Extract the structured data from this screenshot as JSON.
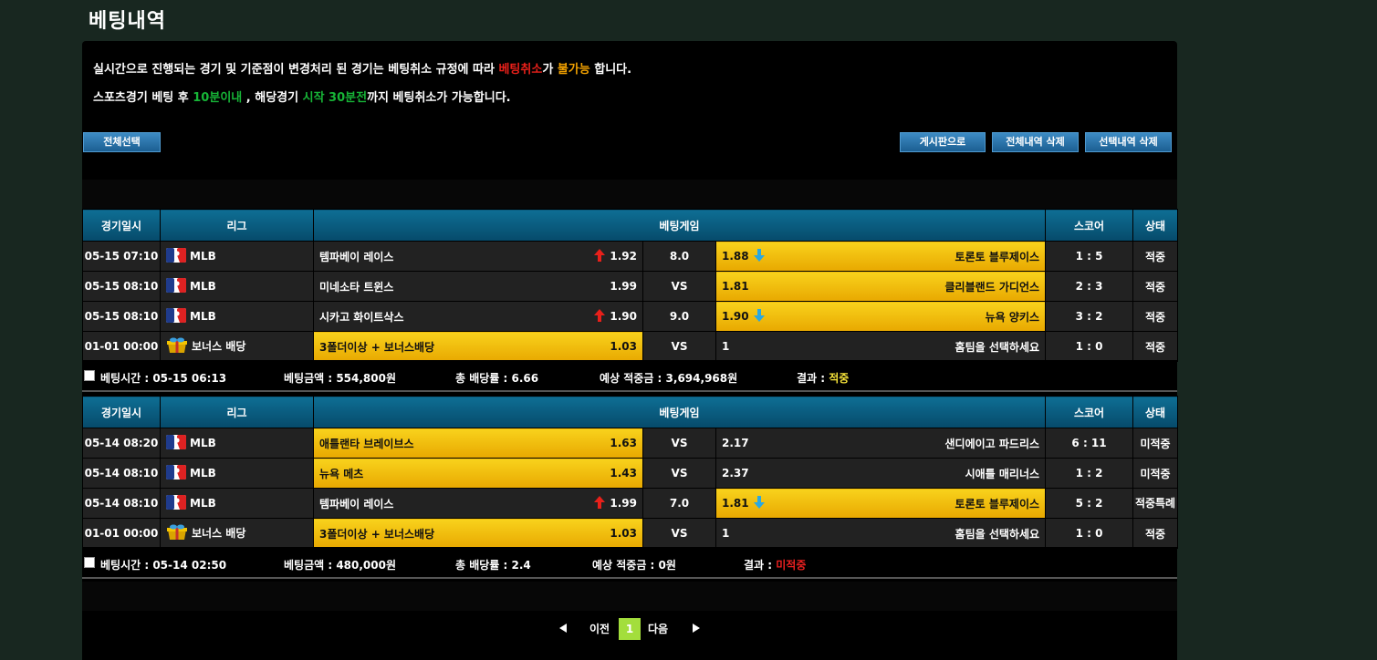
{
  "page_title": "베팅내역",
  "notice": {
    "line1_a": "실시간으로 진행되는 경기 및 기준점이 변경처리 된 경기는 베팅취소 규정에 따라 ",
    "line1_red": "베팅취소",
    "line1_b": "가 ",
    "line1_orange": "불가능",
    "line1_c": " 합니다.",
    "line2_a": "스포츠경기 베팅 후 ",
    "line2_green1": "10분이내",
    "line2_b": " , 해당경기 ",
    "line2_green2": "시작 30분전",
    "line2_c": "까지 베팅취소가 가능합니다."
  },
  "buttons": {
    "select_all": "전체선택",
    "to_board": "게시판으로",
    "delete_all": "전체내역 삭제",
    "delete_selected": "선택내역 삭제"
  },
  "headers": {
    "date": "경기일시",
    "league": "리그",
    "game": "베팅게임",
    "score": "스코어",
    "status": "상태"
  },
  "slips": [
    {
      "rows": [
        {
          "date": "05-15 07:10",
          "league": "MLB",
          "league_icon": "mlb-logo-icon",
          "home": "템파베이 레이스",
          "home_odds": "1.92",
          "home_arrow": "up",
          "mid": "8.0",
          "away_odds": "1.88",
          "away_arrow": "down",
          "away": "토론토 블루제이스",
          "pick": "away",
          "score": "1 : 5",
          "status": "적중"
        },
        {
          "date": "05-15 08:10",
          "league": "MLB",
          "league_icon": "mlb-logo-icon",
          "home": "미네소타 트윈스",
          "home_odds": "1.99",
          "home_arrow": "",
          "mid": "VS",
          "away_odds": "1.81",
          "away_arrow": "",
          "away": "클리블랜드 가디언스",
          "pick": "away",
          "score": "2 : 3",
          "status": "적중"
        },
        {
          "date": "05-15 08:10",
          "league": "MLB",
          "league_icon": "mlb-logo-icon",
          "home": "시카고 화이트삭스",
          "home_odds": "1.90",
          "home_arrow": "up",
          "mid": "9.0",
          "away_odds": "1.90",
          "away_arrow": "down",
          "away": "뉴욕 양키스",
          "pick": "away",
          "score": "3 : 2",
          "status": "적중"
        },
        {
          "date": "01-01 00:00",
          "league": "보너스 배당",
          "league_icon": "gift-box-icon",
          "home": "3폴더이상 + 보너스배당",
          "home_odds": "1.03",
          "home_arrow": "",
          "mid": "VS",
          "away_odds": "1",
          "away_arrow": "",
          "away": "홈팀을 선택하세요",
          "pick": "home",
          "score": "1 : 0",
          "status": "적중"
        }
      ],
      "summary": {
        "time_label": "베팅시간 : ",
        "time": "05-15 06:13",
        "amount_label": "베팅금액 : ",
        "amount": "554,800원",
        "rate_label": "총 배당률 : ",
        "rate": "6.66",
        "expected_label": "예상 적중금 : ",
        "expected": "3,694,968원",
        "result_label": "결과 : ",
        "result": "적중"
      }
    },
    {
      "rows": [
        {
          "date": "05-14 08:20",
          "league": "MLB",
          "league_icon": "mlb-logo-icon",
          "home": "애틀랜타 브레이브스",
          "home_odds": "1.63",
          "home_arrow": "",
          "mid": "VS",
          "away_odds": "2.17",
          "away_arrow": "",
          "away": "샌디에이고 파드리스",
          "pick": "home",
          "score": "6 : 11",
          "status": "미적중"
        },
        {
          "date": "05-14 08:10",
          "league": "MLB",
          "league_icon": "mlb-logo-icon",
          "home": "뉴욕 메츠",
          "home_odds": "1.43",
          "home_arrow": "",
          "mid": "VS",
          "away_odds": "2.37",
          "away_arrow": "",
          "away": "시애틀 매리너스",
          "pick": "home",
          "score": "1 : 2",
          "status": "미적중"
        },
        {
          "date": "05-14 08:10",
          "league": "MLB",
          "league_icon": "mlb-logo-icon",
          "home": "템파베이 레이스",
          "home_odds": "1.99",
          "home_arrow": "up",
          "mid": "7.0",
          "away_odds": "1.81",
          "away_arrow": "down",
          "away": "토론토 블루제이스",
          "pick": "away",
          "score": "5 : 2",
          "status": "적중특례"
        },
        {
          "date": "01-01 00:00",
          "league": "보너스 배당",
          "league_icon": "gift-box-icon",
          "home": "3폴더이상 + 보너스배당",
          "home_odds": "1.03",
          "home_arrow": "",
          "mid": "VS",
          "away_odds": "1",
          "away_arrow": "",
          "away": "홈팀을 선택하세요",
          "pick": "home",
          "score": "1 : 0",
          "status": "적중"
        }
      ],
      "summary": {
        "time_label": "베팅시간 : ",
        "time": "05-14 02:50",
        "amount_label": "베팅금액 : ",
        "amount": "480,000원",
        "rate_label": "총 배당률 : ",
        "rate": "2.4",
        "expected_label": "예상 적중금 : ",
        "expected": "0원",
        "result_label": "결과 : ",
        "result": "미적중"
      }
    }
  ],
  "pagination": {
    "prev": "이전",
    "current": "1",
    "next": "다음"
  },
  "colors": {
    "background": "#182720",
    "header_blue": "#0e6e94",
    "pick_yellow": "#f8d21c",
    "win_yellow": "#f6e33a",
    "lose_red": "#ea2020",
    "special_green": "#35e86a",
    "arrow_up": "#e8201a",
    "arrow_down": "#2aa8e0",
    "page_current": "#a3de3c"
  }
}
